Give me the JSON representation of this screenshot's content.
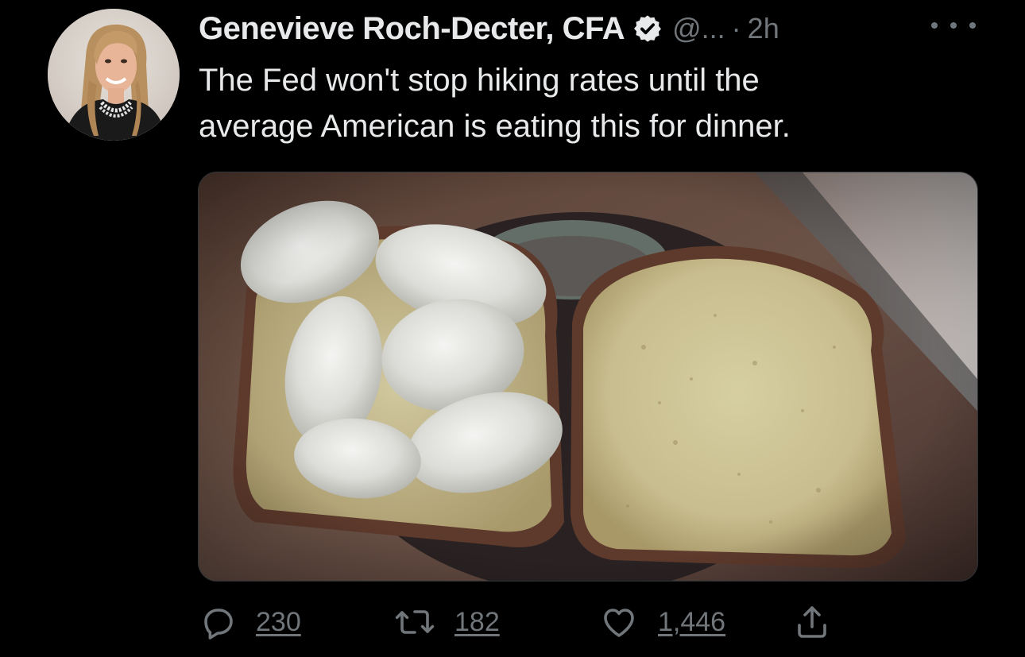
{
  "author": {
    "display_name": "Genevieve Roch-Decter, CFA",
    "handle": "@...",
    "separator": "·",
    "time": "2h"
  },
  "tweet": {
    "text_line_1": "The Fed won't stop hiking rates until the",
    "text_line_2": "average American is eating this for dinner."
  },
  "metrics": {
    "replies": "230",
    "retweets": "182",
    "likes": "1,446"
  },
  "icons": {
    "verified": "verified-badge-icon",
    "more": "more-dots-icon",
    "reply": "reply-bubble-icon",
    "retweet": "retweet-icon",
    "like": "heart-icon",
    "share": "share-upload-icon"
  },
  "colors": {
    "background": "#000000",
    "text_primary": "#e7e9ea",
    "text_secondary": "#71767b"
  }
}
